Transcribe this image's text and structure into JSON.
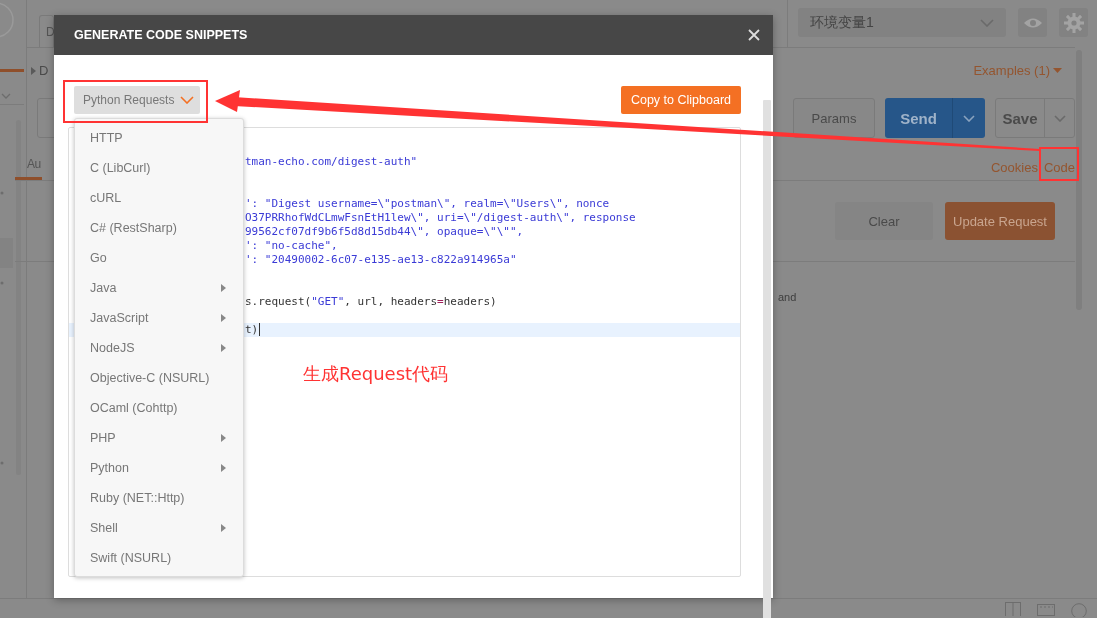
{
  "background": {
    "tab": "D",
    "collection": "D",
    "environment": "环境变量1",
    "examples_link": "Examples (1)",
    "params_button": "Params",
    "send_button": "Send",
    "save_button": "Save",
    "auth_tab": "Au",
    "links": [
      "Cookies",
      "Code"
    ],
    "clear_button": "Clear",
    "update_button": "Update Request",
    "response_text": "and"
  },
  "modal": {
    "title": "GENERATE CODE SNIPPETS",
    "language_select": "Python Requests",
    "copy_button": "Copy to Clipboard",
    "code_lines": [
      {
        "kind": "blank",
        "highlighted": false
      },
      {
        "kind": "string",
        "text": "tman-echo.com/digest-auth\"",
        "highlighted": false
      },
      {
        "kind": "blank",
        "highlighted": false
      },
      {
        "kind": "blank",
        "highlighted": false
      },
      {
        "kind": "string",
        "text": "': \"Digest username=\\\"postman\\\", realm=\\\"Users\\\", nonce",
        "highlighted": false
      },
      {
        "kind": "string",
        "text": "O37PRRhofWdCLmwFsnEtH1lew\\\", uri=\\\"/digest-auth\\\", response",
        "highlighted": false
      },
      {
        "kind": "string",
        "text": "99562cf07df9b6f5d8d15db44\\\", opaque=\\\"\\\"\",",
        "highlighted": false
      },
      {
        "kind": "string",
        "text": "': \"no-cache\",",
        "highlighted": false
      },
      {
        "kind": "string",
        "text": "': \"20490002-6c07-e135-ae13-c822a914965a\"",
        "highlighted": false
      },
      {
        "kind": "blank",
        "highlighted": false
      },
      {
        "kind": "blank",
        "highlighted": false
      },
      {
        "kind": "code",
        "text": "s.request(\"GET\", url, headers=headers)",
        "highlighted": false
      },
      {
        "kind": "blank",
        "highlighted": false
      },
      {
        "kind": "code",
        "text": "t)",
        "highlighted": true
      }
    ],
    "language_menu": [
      {
        "label": "HTTP",
        "has_submenu": false
      },
      {
        "label": "C (LibCurl)",
        "has_submenu": false
      },
      {
        "label": "cURL",
        "has_submenu": false
      },
      {
        "label": "C# (RestSharp)",
        "has_submenu": false
      },
      {
        "label": "Go",
        "has_submenu": false
      },
      {
        "label": "Java",
        "has_submenu": true
      },
      {
        "label": "JavaScript",
        "has_submenu": true
      },
      {
        "label": "NodeJS",
        "has_submenu": true
      },
      {
        "label": "Objective-C (NSURL)",
        "has_submenu": false
      },
      {
        "label": "OCaml (Cohttp)",
        "has_submenu": false
      },
      {
        "label": "PHP",
        "has_submenu": true
      },
      {
        "label": "Python",
        "has_submenu": true
      },
      {
        "label": "Ruby (NET::Http)",
        "has_submenu": false
      },
      {
        "label": "Shell",
        "has_submenu": true
      },
      {
        "label": "Swift (NSURL)",
        "has_submenu": false
      }
    ]
  },
  "annotation": {
    "label": "生成Request代码"
  }
}
